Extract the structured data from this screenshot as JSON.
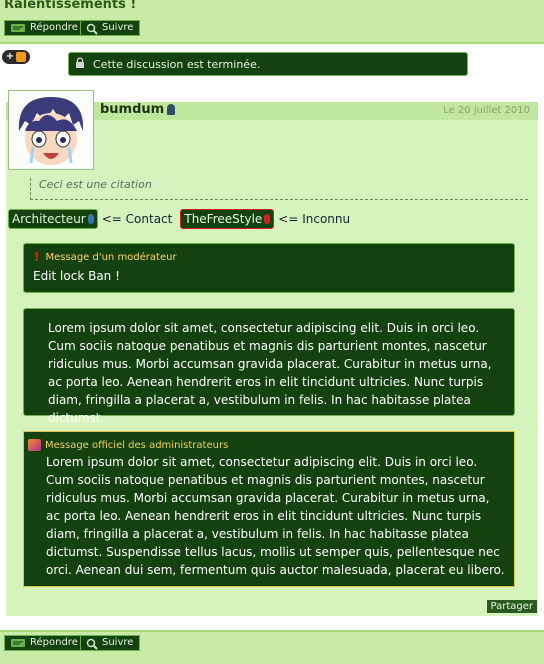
{
  "page": {
    "title": "Ralentissements !"
  },
  "toolbar": {
    "reply_label": "Répondre",
    "follow_label": "Suivre"
  },
  "notice": {
    "locked_text": "Cette discussion est terminée."
  },
  "post": {
    "username": "bumdum",
    "date": "Le 20 juillet 2010",
    "quote": "Ceci est une citation",
    "legend": [
      {
        "badge": "Architecteur",
        "text": "<= Contact",
        "color": "#3c6fa5"
      },
      {
        "badge": "TheFreeStyle",
        "text": "<= Inconnu",
        "color": "#d12020"
      }
    ],
    "moderator": {
      "title": "Message d'un modérateur",
      "text": "Edit lock Ban !"
    },
    "lorem": "Lorem ipsum dolor sit amet, consectetur adipiscing elit. Duis in orci leo. Cum sociis natoque penatibus et magnis dis parturient montes, nascetur ridiculus mus. Morbi accumsan gravida placerat. Curabitur in metus urna, ac porta leo. Aenean hendrerit eros in elit tincidunt ultricies. Nunc turpis diam, fringilla a placerat a, vestibulum in felis. In hac habitasse platea dictumst.",
    "admin": {
      "title": "Message officiel des administrateurs",
      "text": "Lorem ipsum dolor sit amet, consectetur adipiscing elit. Duis in orci leo. Cum sociis natoque penatibus et magnis dis parturient montes, nascetur ridiculus mus. Morbi accumsan gravida placerat. Curabitur in metus urna, ac porta leo. Aenean hendrerit eros in elit tincidunt ultricies. Nunc turpis diam, fringilla a placerat a, vestibulum in felis. In hac habitasse platea dictumst. Suspendisse tellus lacus, mollis ut semper quis, pellentesque nec orci. Aenean dui sem, fermentum quis auctor malesuada, placerat eu libero."
    },
    "share_label": "Partager"
  },
  "colors": {
    "accent_dark_green": "#13420f",
    "light_green": "#d7f3bd",
    "admin_border": "#d9c349"
  }
}
